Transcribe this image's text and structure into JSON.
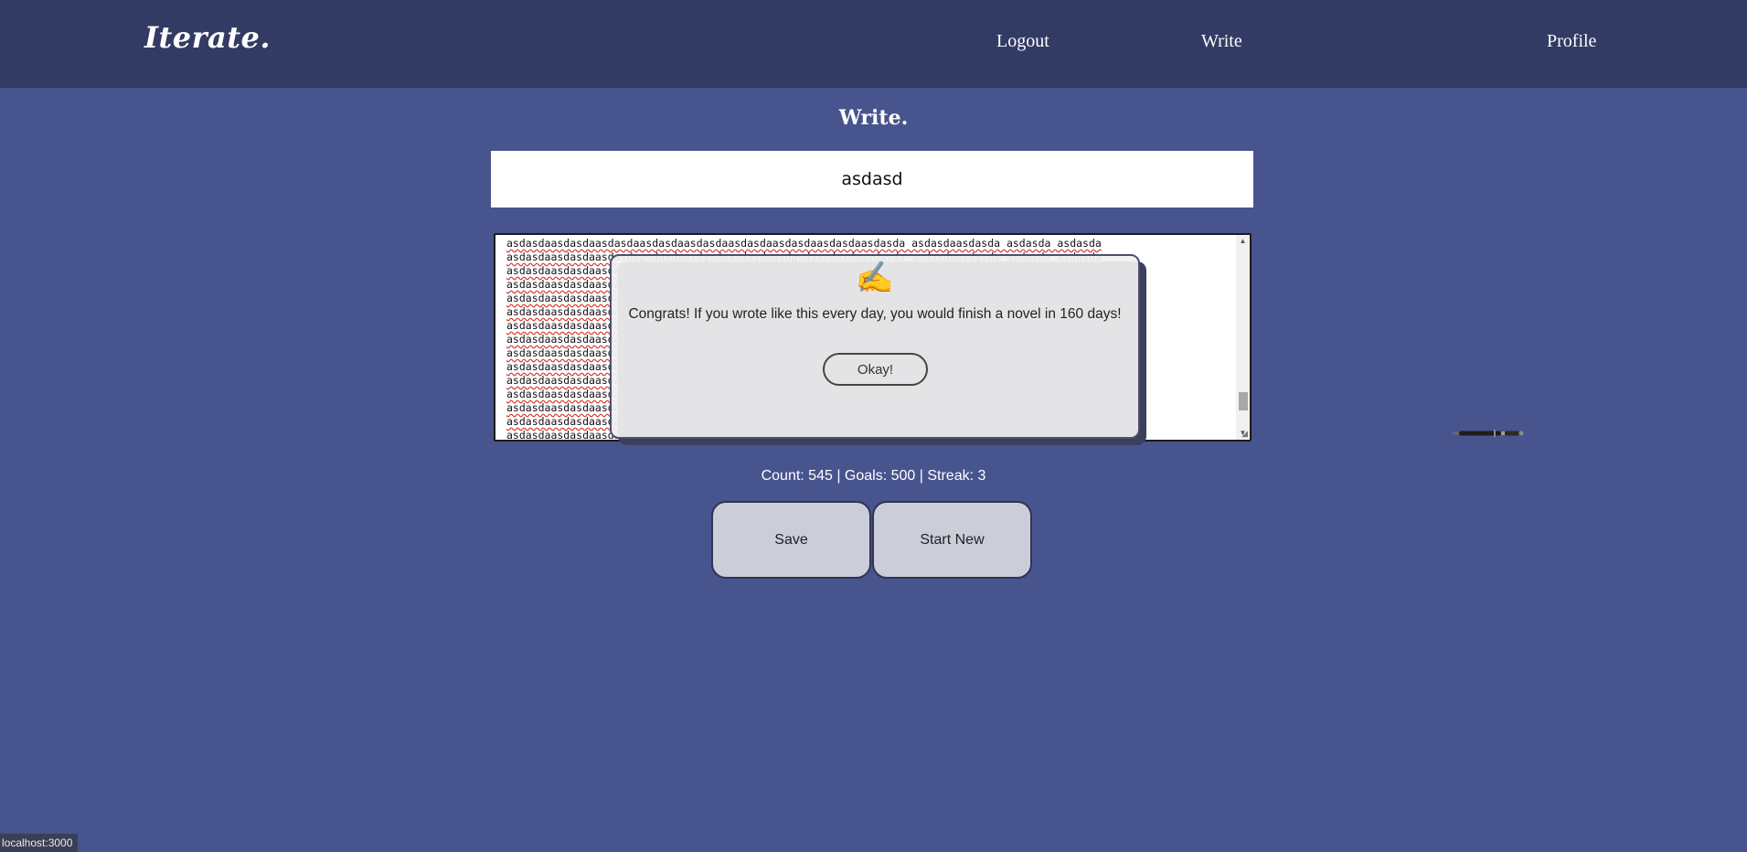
{
  "nav": {
    "brand": "Iterate.",
    "links": [
      "Logout",
      "Write",
      "Profile"
    ]
  },
  "page": {
    "title": "Write.",
    "title_input_value": "asdasd",
    "editor_lines": [
      "asdasdaasdasdaasdasdaasdasdaasdasdaasdasdaasdasdaasdasdaasdasda asdasdaasdasda asdasda asdasda",
      "asdasdaasdasdaasdasdaasdasdaasdasdaasdasdaasdasdaasdasdaasdasda asdasdaasdasda asdasda asdasda",
      "asdasdaasdasdaasdasdaasdasdaasdasdaasdasdaasdasdaasdasdaasdasda asdasdaasdasda asdasda asdasda",
      "asdasdaasdasdaasdasdaasdasdaasdasdaasdasdaasdasdaasdasdaasdasda asdasdaasdasda asdasda asdasda",
      "asdasdaasdasdaasdasdaasdasdaasdasdaasdasdaasdasdaasdasdaasdasda asdasdaasdasda asdasda asdasda",
      "asdasdaasdasdaasdasdaasdasdaasdasdaasdasdaasdasdaasdasdaasdasda asdasdaasdasda asdasda asdasda",
      "asdasdaasdasdaasdasdaasdasdaasdasdaasdasdaasdasdaasdasdaasdasda asdasdaasdasda asdasda asdasda",
      "asdasdaasdasdaasdasdaasdasdaasdasdaasdasdaasdasdaasdasdaasdasda asdasdaasdasda asdasda asdasda",
      "asdasdaasdasdaasdasdaasdasdaasdasdaasdasdaasdasdaasdasdaasdasda asdasdaasdasda asdasda asdasda",
      "asdasdaasdasdaasdasdaasdasdaasdasdaasdasdaasdasdaasdasdaasdasda asdasdaasdasda asdasda asdasda",
      "asdasdaasdasdaasdasdaasdasdaasdasdaasdasdaasdasdaasdasdaasdasda asdasdaasdasda asdasda asdasda",
      "asdasdaasdasdaasdasdaasdasdaasdasdaasdasdaasdasdaasdasdaasdasda asdasdaasdasda asdasda asdasda",
      "asdasdaasdasdaasdasdaasdasdaasdasdaasdasdaasdasdaasdasdaasdasda asdasdaasdasda asdasda asdasda",
      "asdasdaasdasdaasdasdaasdasdaasdasdaasdasdaasdasdaasdasdaasdasda asdasdaasdasda asdasda asdasda",
      "asdasdaasdasdaasdasdaasdasdaasdasdaasdasdaasdasdaasdasdaasdasda asdasdaasdasda asdasda asdasda"
    ],
    "stats": "Count: 545 | Goals: 500 | Streak: 3",
    "save_label": "Save",
    "start_new_label": "Start New"
  },
  "modal": {
    "icon": "writing-hand-icon",
    "glyph": "✍️",
    "message": "Congrats! If you wrote like this every day, you would finish a novel in 160 days!",
    "button_label": "Okay!"
  },
  "decor": {
    "pen_icon": "fountain-pen-icon"
  },
  "status_bar": {
    "url": "localhost:3000"
  },
  "colors": {
    "background": "#48548d",
    "nav": "#323b64",
    "button": "#cbcdd9"
  }
}
